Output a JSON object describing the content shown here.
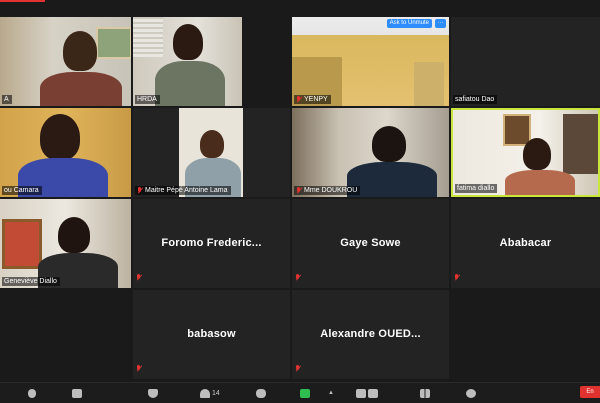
{
  "participants": [
    {
      "name": "A",
      "muted": false
    },
    {
      "name": "HRDA",
      "muted": false
    },
    {
      "name": "YENPY",
      "muted": true
    },
    {
      "name": "safiatou Dao",
      "muted": false
    },
    {
      "name": "ou Camara",
      "muted": false
    },
    {
      "name": "Maitre Pépé Antoine Lama",
      "muted": true
    },
    {
      "name": "Mme DOUKROU",
      "muted": true
    },
    {
      "name": "fatima diallo",
      "muted": false
    },
    {
      "name": "Geneviève Diallo",
      "muted": false
    },
    {
      "name": "Foromo  Frederic...",
      "muted": true
    },
    {
      "name": "Gaye Sowe",
      "muted": true
    },
    {
      "name": "Abababacar",
      "muted": true
    },
    {
      "name": "babasow",
      "muted": true
    },
    {
      "name": "Alexandre  OUED...",
      "muted": true
    }
  ],
  "tiles": {
    "foromo": "Foromo  Frederic...",
    "gaye": "Gaye Sowe",
    "ababacar": "Ababacar",
    "babasow": "babasow",
    "alexandre": "Alexandre  OUED..."
  },
  "labels": {
    "a": "A",
    "hrda": "HRDA",
    "yenpy": "YENPY",
    "safiatou": "safiatou Dao",
    "camara": "ou Camara",
    "pepe": "Maitre Pépé Antoine Lama",
    "doukrou": "Mme DOUKROU",
    "fatima": "fatima diallo",
    "genevieve": "Geneviève Diallo"
  },
  "yenpy_controls": {
    "ask_unmute": "Ask to Unmute",
    "more": "···"
  },
  "toolbar": {
    "participants_count": "14",
    "end_label": "En"
  },
  "colors": {
    "active_speaker": "#c8e63c",
    "mute_red": "#e0322e",
    "button_blue": "#2d8cff"
  }
}
